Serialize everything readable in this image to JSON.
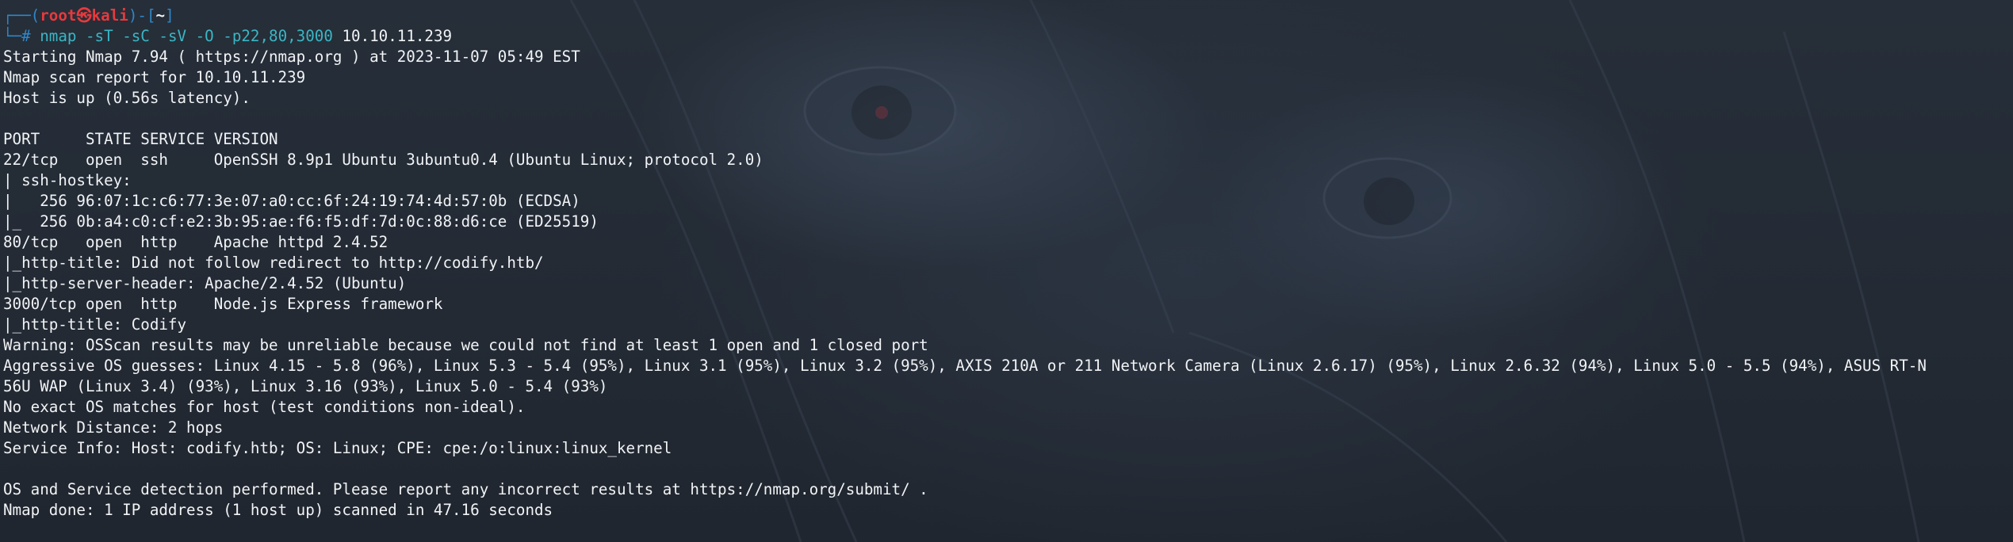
{
  "prompt": {
    "box_top_left": "┌──(",
    "user": "root",
    "at": "㉿",
    "host": "kali",
    "mid": ")-[",
    "cwd": "~",
    "box_close": "]",
    "box_bottom_left": "└─",
    "symbol": "#",
    "command": "nmap -sT -sC -sV -O -p22,80,3000",
    "target": "10.10.11.239"
  },
  "output_lines": [
    "Starting Nmap 7.94 ( https://nmap.org ) at 2023-11-07 05:49 EST",
    "Nmap scan report for 10.10.11.239",
    "Host is up (0.56s latency).",
    "",
    "PORT     STATE SERVICE VERSION",
    "22/tcp   open  ssh     OpenSSH 8.9p1 Ubuntu 3ubuntu0.4 (Ubuntu Linux; protocol 2.0)",
    "| ssh-hostkey:",
    "|   256 96:07:1c:c6:77:3e:07:a0:cc:6f:24:19:74:4d:57:0b (ECDSA)",
    "|_  256 0b:a4:c0:cf:e2:3b:95:ae:f6:f5:df:7d:0c:88:d6:ce (ED25519)",
    "80/tcp   open  http    Apache httpd 2.4.52",
    "|_http-title: Did not follow redirect to http://codify.htb/",
    "|_http-server-header: Apache/2.4.52 (Ubuntu)",
    "3000/tcp open  http    Node.js Express framework",
    "|_http-title: Codify",
    "Warning: OSScan results may be unreliable because we could not find at least 1 open and 1 closed port",
    "Aggressive OS guesses: Linux 4.15 - 5.8 (96%), Linux 5.3 - 5.4 (95%), Linux 3.1 (95%), Linux 3.2 (95%), AXIS 210A or 211 Network Camera (Linux 2.6.17) (95%), Linux 2.6.32 (94%), Linux 5.0 - 5.5 (94%), ASUS RT-N",
    "56U WAP (Linux 3.4) (93%), Linux 3.16 (93%), Linux 5.0 - 5.4 (93%)",
    "No exact OS matches for host (test conditions non-ideal).",
    "Network Distance: 2 hops",
    "Service Info: Host: codify.htb; OS: Linux; CPE: cpe:/o:linux:linux_kernel",
    "",
    "OS and Service detection performed. Please report any incorrect results at https://nmap.org/submit/ .",
    "Nmap done: 1 IP address (1 host up) scanned in 47.16 seconds"
  ],
  "colors": {
    "background": "#242b36",
    "prompt_box": "#2f87c9",
    "prompt_user": "#e8393c",
    "command": "#3ab6c4",
    "text": "#f1f3f5"
  }
}
